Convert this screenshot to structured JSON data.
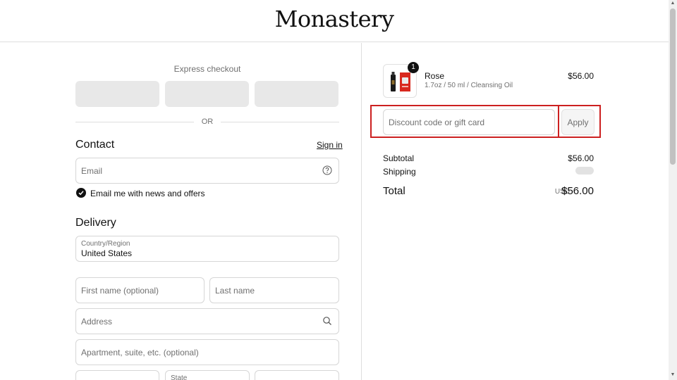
{
  "header": {
    "logo": "Monastery"
  },
  "checkout": {
    "express_title": "Express checkout",
    "or_text": "OR",
    "contact": {
      "title": "Contact",
      "sign_in": "Sign in",
      "email_placeholder": "Email",
      "news_label": "Email me with news and offers",
      "news_checked": true
    },
    "delivery": {
      "title": "Delivery",
      "country_label": "Country/Region",
      "country_value": "United States",
      "first_name_placeholder": "First name (optional)",
      "last_name_placeholder": "Last name",
      "address_placeholder": "Address",
      "apartment_placeholder": "Apartment, suite, etc. (optional)",
      "state_label": "State"
    }
  },
  "summary": {
    "product": {
      "name": "Rose",
      "variant": "1.7oz / 50 ml / Cleansing Oil",
      "price": "$56.00",
      "quantity": "1"
    },
    "discount_placeholder": "Discount code or gift card",
    "apply_label": "Apply",
    "subtotal_label": "Subtotal",
    "subtotal_value": "$56.00",
    "shipping_label": "Shipping",
    "total_label": "Total",
    "total_currency": "USD",
    "total_value": "$56.00"
  },
  "icons": {
    "email_help": "question-circle-icon",
    "address_search": "search-icon",
    "check": "checkmark-icon"
  },
  "colors": {
    "highlight": "#cc2020",
    "express_button": "#e8e8e8",
    "border": "#d6d6d6"
  }
}
